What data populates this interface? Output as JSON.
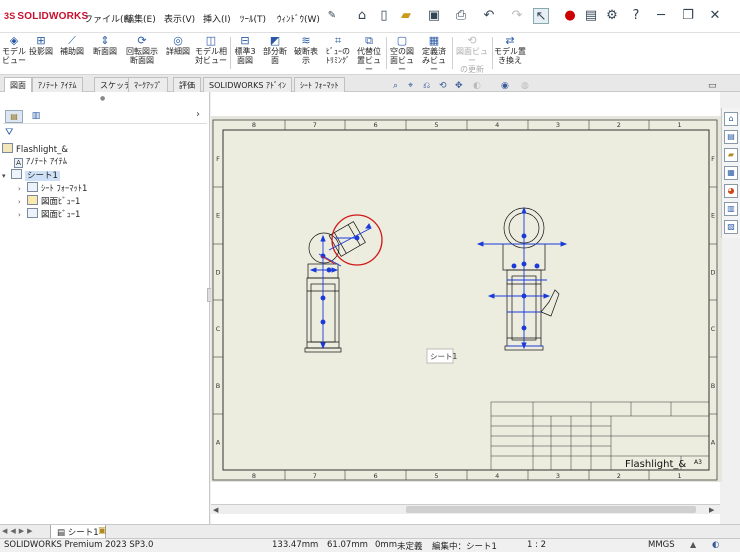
{
  "app": {
    "logo_prefix": "3S",
    "logo_text": "SOLIDWORKS"
  },
  "menu": [
    {
      "id": "file",
      "label": "ファイル(F)"
    },
    {
      "id": "edit",
      "label": "編集(E)"
    },
    {
      "id": "view",
      "label": "表示(V)"
    },
    {
      "id": "insert",
      "label": "挿入(I)"
    },
    {
      "id": "tools",
      "label": "ﾂｰﾙ(T)"
    },
    {
      "id": "window",
      "label": "ｳｨﾝﾄﾞｳ(W)"
    }
  ],
  "commands": [
    {
      "l1": "モデル",
      "l2": "ビュー"
    },
    {
      "l1": "投影図",
      "l2": ""
    },
    {
      "l1": "補助図",
      "l2": ""
    },
    {
      "l1": "断面図",
      "l2": ""
    },
    {
      "l1": "回転図示",
      "l2": "断面図"
    },
    {
      "l1": "詳細図",
      "l2": ""
    },
    {
      "l1": "モデル相",
      "l2": "対ビュー"
    },
    {
      "l1": "標準3",
      "l2": "面図"
    },
    {
      "l1": "部分断",
      "l2": "面"
    },
    {
      "l1": "破断表",
      "l2": "示"
    },
    {
      "l1": "ﾋﾞｭｰの",
      "l2": "ﾄﾘﾐﾝｸﾞ"
    },
    {
      "l1": "代替位",
      "l2": "置ビュー"
    },
    {
      "l1": "空の図",
      "l2": "面ビュー"
    },
    {
      "l1": "定義済",
      "l2": "みビュー"
    },
    {
      "l1": "図面ビュー",
      "l2": "の更新"
    },
    {
      "l1": "モデル置",
      "l2": "き換え"
    }
  ],
  "tabs": [
    "図面",
    "ｱﾉﾃｰﾄ ｱｲﾃﾑ",
    "スケッチ",
    "ﾏｰｸｱｯﾌﾟ",
    "評価",
    "SOLIDWORKS ｱﾄﾞｲﾝ",
    "ｼｰﾄ ﾌｫｰﾏｯﾄ"
  ],
  "tree": {
    "root": "Flashlight_&",
    "annotations": "ｱﾉﾃｰﾄ ｱｲﾃﾑ",
    "sheet": "シート1",
    "children": [
      "ｼｰﾄ ﾌｫｰﾏｯﾄ1",
      "図面ﾋﾞｭｰ1",
      "図面ﾋﾞｭｰ2"
    ]
  },
  "drawing": {
    "cols": [
      "8",
      "7",
      "6",
      "5",
      "4",
      "3",
      "2",
      "1"
    ],
    "rows": [
      "F",
      "E",
      "D",
      "C",
      "B",
      "A"
    ],
    "sheet_label": "シート1",
    "title": "Flashlight_&",
    "size": "A3"
  },
  "sheet_tab": "シート1",
  "status": {
    "product": "SOLIDWORKS Premium 2023 SP3.0",
    "x": "133.47mm",
    "y": "61.07mm",
    "z": "0mm",
    "state": "未定義",
    "editing": "編集中：シート1",
    "scale": "1 : 2",
    "units": "MMGS"
  },
  "colors": {
    "brand": "#c8102e",
    "dimension_blue": "#1a3ad8",
    "sheet_bg": "#ececdf",
    "highlight": "#d01818"
  }
}
